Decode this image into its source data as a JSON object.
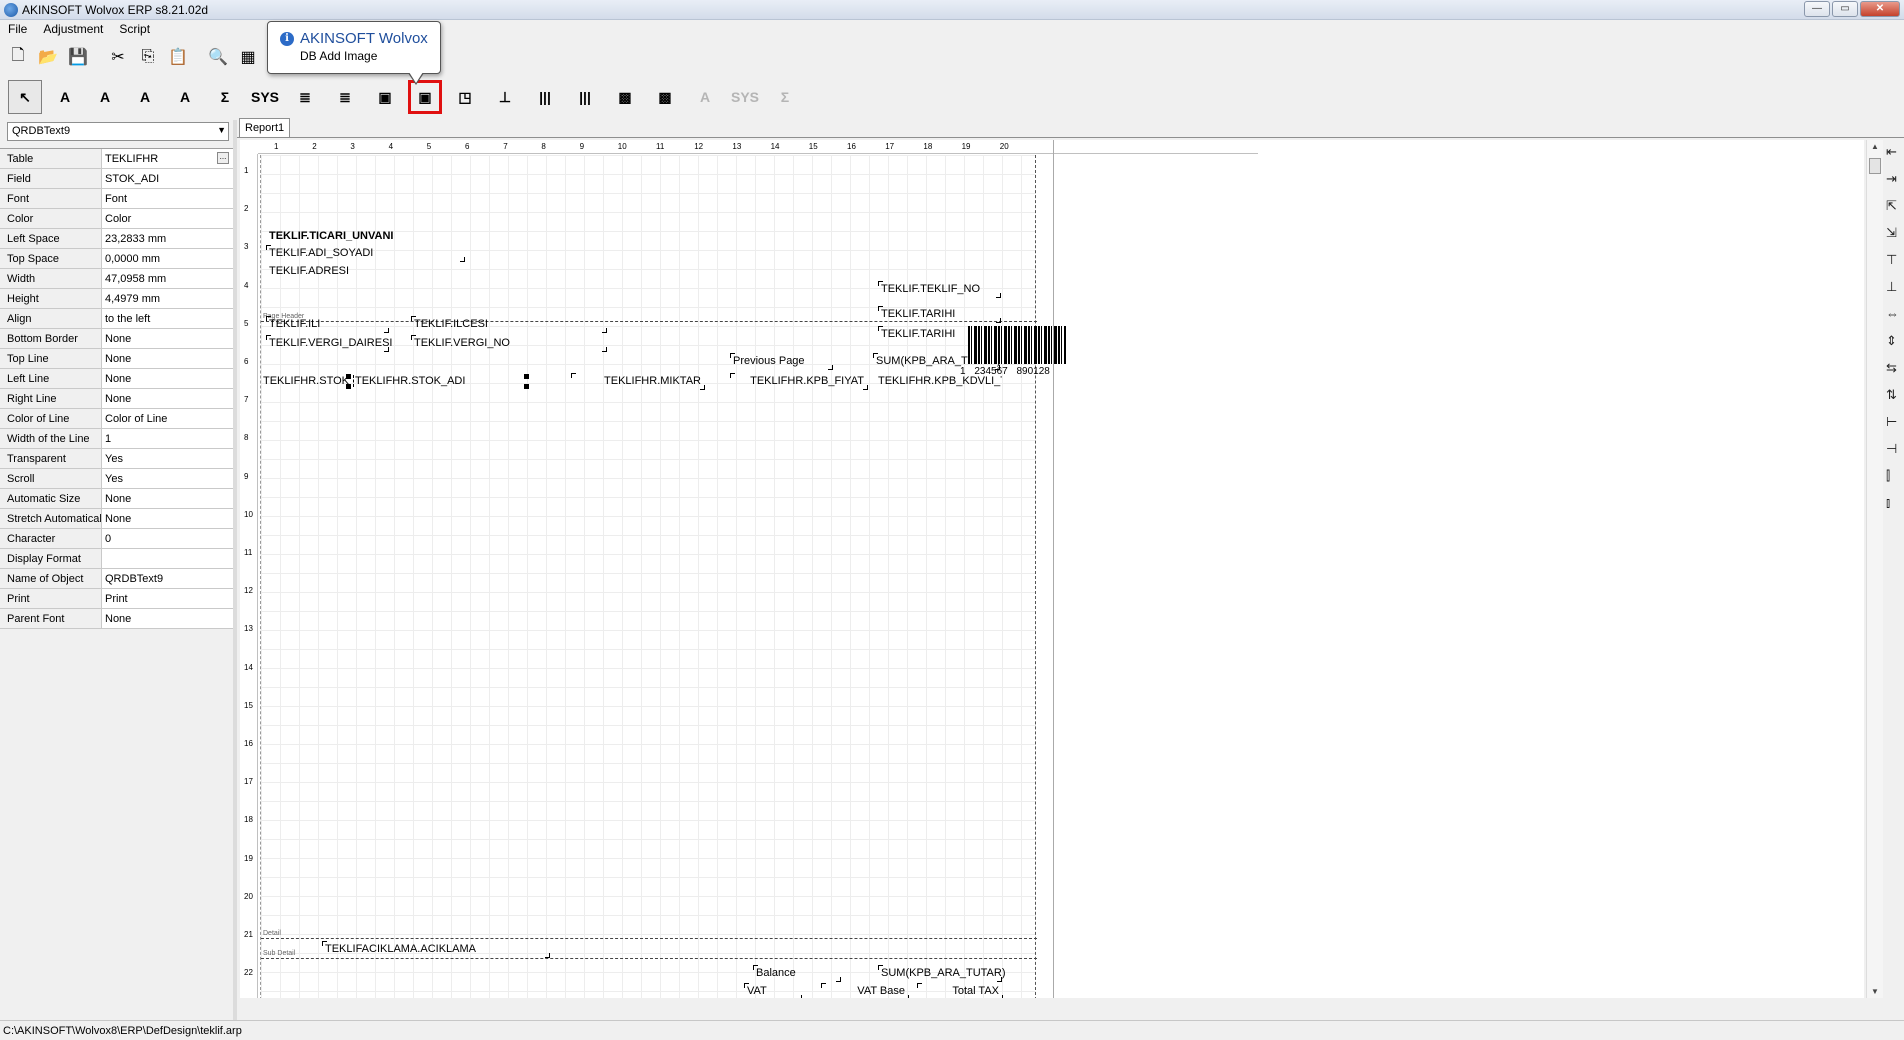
{
  "window": {
    "title": "AKINSOFT Wolvox ERP s8.21.02d",
    "min": "—",
    "max": "▭",
    "close": "✕"
  },
  "menu": [
    {
      "label": "File"
    },
    {
      "label": "Adjustment"
    },
    {
      "label": "Script"
    }
  ],
  "toolbar_main": [
    {
      "name": "new-icon",
      "glyph": "🗋"
    },
    {
      "name": "open-icon",
      "glyph": "📂"
    },
    {
      "name": "save-icon",
      "glyph": "💾"
    },
    {
      "name": "cut-icon",
      "glyph": "✂"
    },
    {
      "name": "copy-icon",
      "glyph": "⎘"
    },
    {
      "name": "paste-icon",
      "glyph": "📋"
    },
    {
      "name": "preview-icon",
      "glyph": "🔍"
    },
    {
      "name": "grid-icon",
      "glyph": "▦"
    }
  ],
  "toolbar_tools": [
    {
      "name": "pointer-tool",
      "glyph": "↖",
      "state": "selected"
    },
    {
      "name": "text-tool",
      "glyph": "A"
    },
    {
      "name": "db-text-tool",
      "glyph": "A"
    },
    {
      "name": "rich-text-tool",
      "glyph": "A"
    },
    {
      "name": "db-rich-text-tool",
      "glyph": "A"
    },
    {
      "name": "expression-tool",
      "glyph": "Σ"
    },
    {
      "name": "sys-data-tool",
      "glyph": "SYS"
    },
    {
      "name": "memo-tool",
      "glyph": "≣"
    },
    {
      "name": "db-memo-tool",
      "glyph": "≣"
    },
    {
      "name": "image-tool",
      "glyph": "▣"
    },
    {
      "name": "db-image-tool",
      "glyph": "▣",
      "state": "highlight"
    },
    {
      "name": "shape-tool",
      "glyph": "◳"
    },
    {
      "name": "line-tool",
      "glyph": "⊥"
    },
    {
      "name": "barcode-tool",
      "glyph": "|||"
    },
    {
      "name": "db-barcode-tool",
      "glyph": "|||"
    },
    {
      "name": "dm-barcode-tool",
      "glyph": "▩"
    },
    {
      "name": "db-dm-barcode-tool",
      "glyph": "▩"
    },
    {
      "name": "disabled-text-tool",
      "glyph": "A",
      "state": "disabled"
    },
    {
      "name": "disabled-sys-tool",
      "glyph": "SYS",
      "state": "disabled"
    },
    {
      "name": "disabled-sum-tool",
      "glyph": "Σ",
      "state": "disabled"
    }
  ],
  "tooltip": {
    "title": "AKINSOFT Wolvox",
    "desc": "DB Add Image",
    "icon": "info-icon"
  },
  "inspector": {
    "selected_object": "QRDBText9",
    "rows": [
      {
        "name": "Table",
        "value": "TEKLIFHR",
        "has_button": true
      },
      {
        "name": "Field",
        "value": "STOK_ADI"
      },
      {
        "name": "Font",
        "value": "Font"
      },
      {
        "name": "Color",
        "value": "Color"
      },
      {
        "name": "Left Space",
        "value": "23,2833 mm"
      },
      {
        "name": "Top Space",
        "value": "0,0000 mm"
      },
      {
        "name": "Width",
        "value": "47,0958 mm"
      },
      {
        "name": "Height",
        "value": "4,4979 mm"
      },
      {
        "name": "Align",
        "value": "to the left"
      },
      {
        "name": "Bottom Border",
        "value": "None"
      },
      {
        "name": "Top Line",
        "value": "None"
      },
      {
        "name": "Left Line",
        "value": "None"
      },
      {
        "name": "Right Line",
        "value": "None"
      },
      {
        "name": "Color of Line",
        "value": "Color of Line"
      },
      {
        "name": "Width of the Line",
        "value": "1"
      },
      {
        "name": "Transparent",
        "value": "Yes"
      },
      {
        "name": "Scroll",
        "value": "Yes"
      },
      {
        "name": "Automatic Size",
        "value": "None"
      },
      {
        "name": "Stretch Automaticaly",
        "value": "None"
      },
      {
        "name": "Character",
        "value": "0"
      },
      {
        "name": "Display Format",
        "value": ""
      },
      {
        "name": "Name of Object",
        "value": "QRDBText9"
      },
      {
        "name": "Print",
        "value": "Print"
      },
      {
        "name": "Parent Font",
        "value": "None"
      }
    ]
  },
  "tabs": [
    {
      "label": "Report1"
    }
  ],
  "ruler_h": [
    "1",
    "2",
    "3",
    "4",
    "5",
    "6",
    "7",
    "8",
    "9",
    "10",
    "11",
    "12",
    "13",
    "14",
    "15",
    "16",
    "17",
    "18",
    "19",
    "20"
  ],
  "ruler_v": [
    "1",
    "2",
    "3",
    "4",
    "5",
    "6",
    "7",
    "8",
    "9",
    "10",
    "11",
    "12",
    "13",
    "14",
    "15",
    "16",
    "17",
    "18",
    "19",
    "20",
    "21",
    "22"
  ],
  "bands": {
    "page_header": "Page Header",
    "detail": "Detail",
    "sub_detail": "Sub Detail"
  },
  "barcode": {
    "text": "1 234567 890128"
  },
  "fields": {
    "ticari_unvani": "TEKLIF.TICARI_UNVANI",
    "adi_soyadi": "TEKLIF.ADI_SOYADI",
    "adresi": "TEKLIF.ADRESI",
    "ili": "TEKLIF.ILI",
    "ilcesi": "TEKLIF.ILCESI",
    "vergi_dairesi": "TEKLIF.VERGI_DAIRESI",
    "vergi_no": "TEKLIF.VERGI_NO",
    "teklif_no": "TEKLIF.TEKLIF_NO",
    "tarihi1": "TEKLIF.TARIHI",
    "tarihi2": "TEKLIF.TARIHI",
    "previous_page": "Previous Page",
    "sum_ara_tutar1": "SUM(KPB_ARA_TUTAR)",
    "stok": "TEKLIFHR.STOK",
    "stok_adi": "TEKLIFHR.STOK_ADI",
    "miktar": "TEKLIFHR.MIKTAR",
    "kpb_fiyat": "TEKLIFHR.KPB_FIYAT",
    "kpb_kdvli": "TEKLIFHR.KPB_KDVLI_TU",
    "aciklama": "TEKLIFACIKLAMA.ACIKLAMA",
    "balance": "Balance",
    "sum_ara_tutar2": "SUM(KPB_ARA_TUTAR)",
    "vat": "VAT",
    "vat_base": "VAT Base",
    "total_tax": "Total TAX"
  },
  "status": {
    "path": "C:\\AKINSOFT\\Wolvox8\\ERP\\DefDesign\\teklif.arp"
  }
}
